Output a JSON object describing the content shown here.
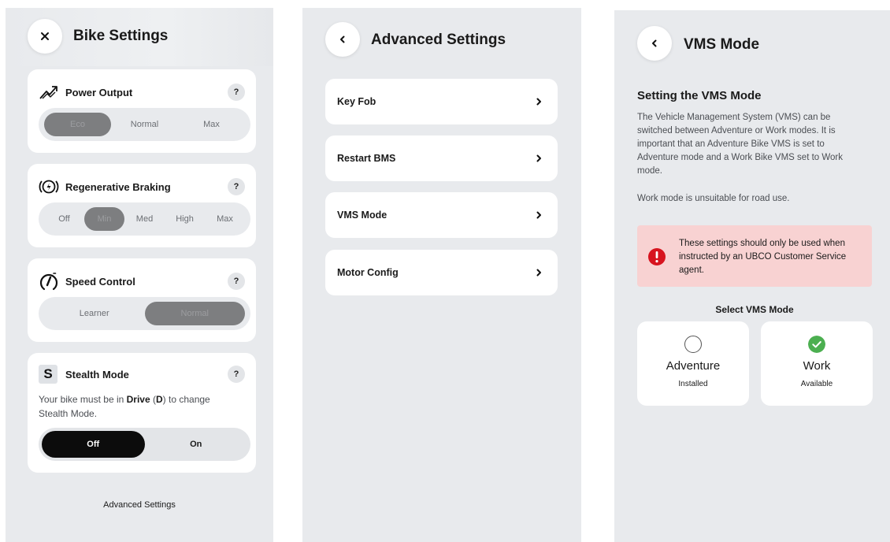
{
  "colors": {
    "panel_bg": "#e8eaed",
    "card_bg": "#ffffff",
    "selected_segment": "#7d7e80",
    "toggle_active": "#0c0c0c",
    "warning_bg": "#f8d2d2",
    "warning_icon": "#d7141f",
    "success_green": "#4caf50"
  },
  "bike_settings": {
    "title": "Bike Settings",
    "close_icon": "close-icon",
    "power_output": {
      "title": "Power Output",
      "icon": "power-arrows-icon",
      "help": "?",
      "options": [
        "Eco",
        "Normal",
        "Max"
      ],
      "selected": "Eco"
    },
    "regen_braking": {
      "title": "Regenerative Braking",
      "icon": "regen-brake-icon",
      "help": "?",
      "options": [
        "Off",
        "Min",
        "Med",
        "High",
        "Max"
      ],
      "selected": "Min"
    },
    "speed_control": {
      "title": "Speed Control",
      "icon": "speedometer-icon",
      "help": "?",
      "options": [
        "Learner",
        "Normal"
      ],
      "selected": "Normal"
    },
    "stealth_mode": {
      "badge": "S",
      "title": "Stealth Mode",
      "help": "?",
      "note_prefix": "Your bike must be in ",
      "note_bold": "Drive",
      "note_paren": " (",
      "note_key": "D",
      "note_suffix": ") to change Stealth Mode.",
      "off_label": "Off",
      "on_label": "On",
      "selected": "Off"
    },
    "footer_link": "Advanced Settings"
  },
  "advanced_settings": {
    "title": "Advanced Settings",
    "back_icon": "chevron-left-icon",
    "items": [
      {
        "label": "Key Fob"
      },
      {
        "label": "Restart BMS"
      },
      {
        "label": "VMS Mode"
      },
      {
        "label": "Motor Config"
      }
    ]
  },
  "vms_mode": {
    "title": "VMS Mode",
    "back_icon": "chevron-left-icon",
    "section_title": "Setting the VMS Mode",
    "description": "The Vehicle Management System (VMS) can be switched between Adventure or Work modes. It is important that an Adventure Bike VMS is set to Adventure mode and a Work Bike VMS set to Work mode.",
    "road_note": "Work mode is unsuitable for road use.",
    "warning_icon": "exclamation-icon",
    "warning": "These settings should only be used when instructed by an UBCO Customer Service agent.",
    "select_label": "Select VMS Mode",
    "modes": [
      {
        "name": "Adventure",
        "status": "Installed",
        "selected": false
      },
      {
        "name": "Work",
        "status": "Available",
        "selected": true
      }
    ]
  }
}
